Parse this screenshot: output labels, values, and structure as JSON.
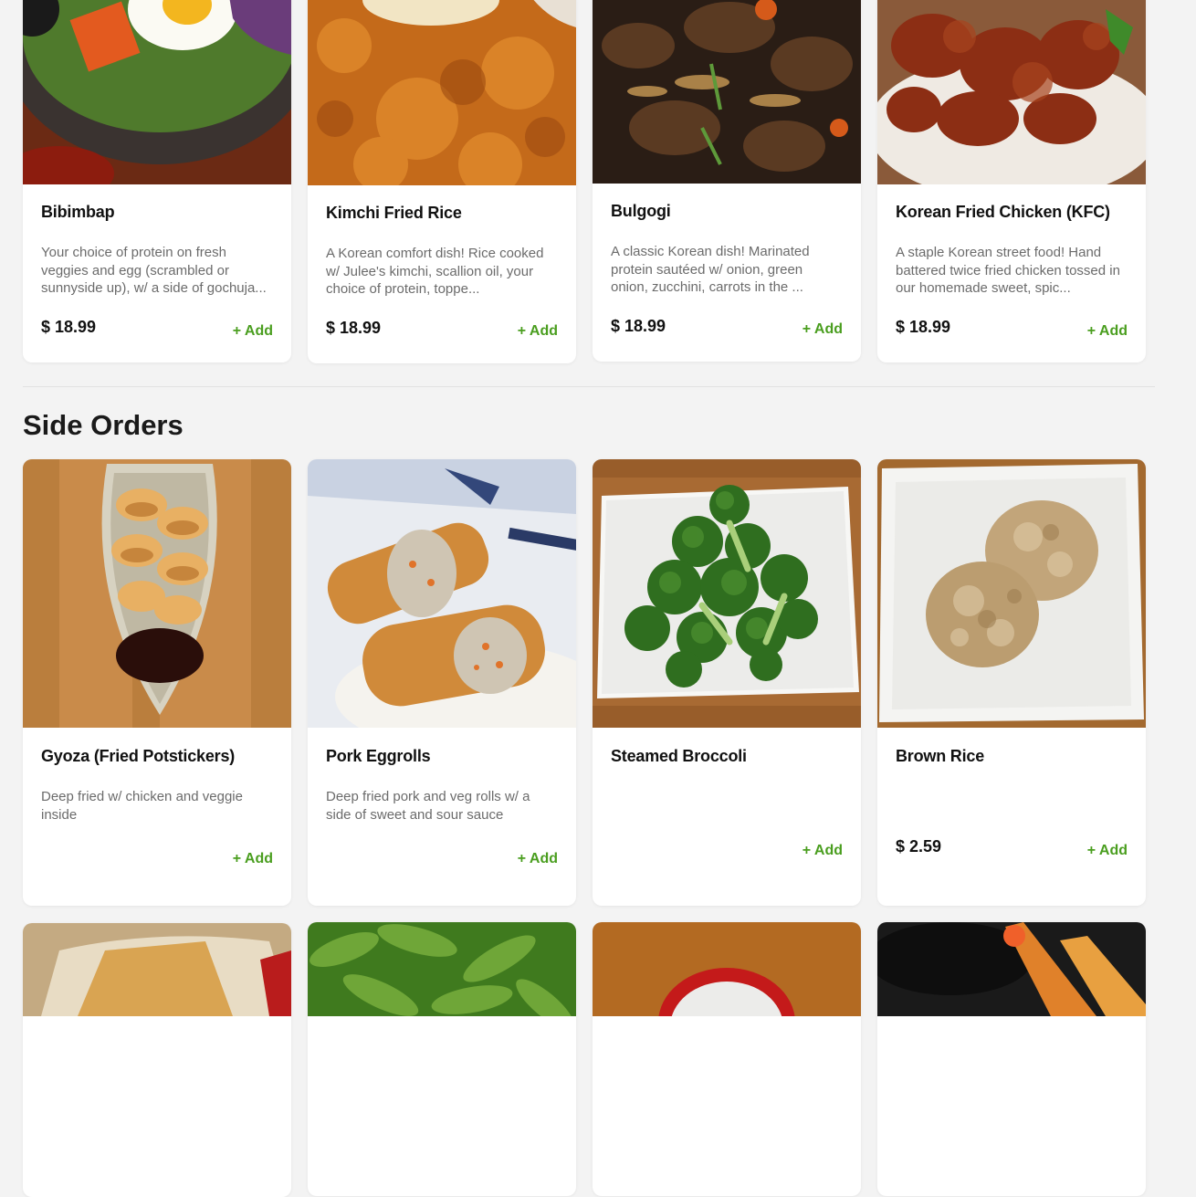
{
  "main_dishes": [
    {
      "title": "Bibimbap",
      "desc": "Your choice of protein on fresh veggies and egg (scrambled or sunnyside up), w/ a side of gochuja...",
      "price": "$ 18.99",
      "add": "+ Add"
    },
    {
      "title": "Kimchi Fried Rice",
      "desc": "A Korean comfort dish! Rice cooked w/ Julee's kimchi, scallion oil, your choice of protein, toppe...",
      "price": "$ 18.99",
      "add": "+ Add"
    },
    {
      "title": "Bulgogi",
      "desc": "A classic Korean dish! Marinated protein sautéed w/ onion, green onion, zucchini, carrots in the ...",
      "price": "$ 18.99",
      "add": "+ Add"
    },
    {
      "title": "Korean Fried Chicken (KFC)",
      "desc": "A staple Korean street food! Hand battered twice fried chicken tossed in our homemade sweet, spic...",
      "price": "$ 18.99",
      "add": "+ Add"
    }
  ],
  "side_orders": {
    "heading": "Side Orders",
    "items": [
      {
        "title": "Gyoza (Fried Potstickers)",
        "desc": "Deep fried w/ chicken and veggie inside",
        "price": "",
        "add": "+ Add"
      },
      {
        "title": "Pork Eggrolls",
        "desc": "Deep fried pork and veg rolls w/ a side of sweet and sour sauce",
        "price": "",
        "add": "+ Add"
      },
      {
        "title": "Steamed Broccoli",
        "desc": "",
        "price": "",
        "add": "+ Add"
      },
      {
        "title": "Brown Rice",
        "desc": "",
        "price": "$ 2.59",
        "add": "+ Add"
      }
    ]
  },
  "colors": {
    "accent": "#4a9e1f",
    "background": "#f3f3f3",
    "card": "#ffffff"
  }
}
